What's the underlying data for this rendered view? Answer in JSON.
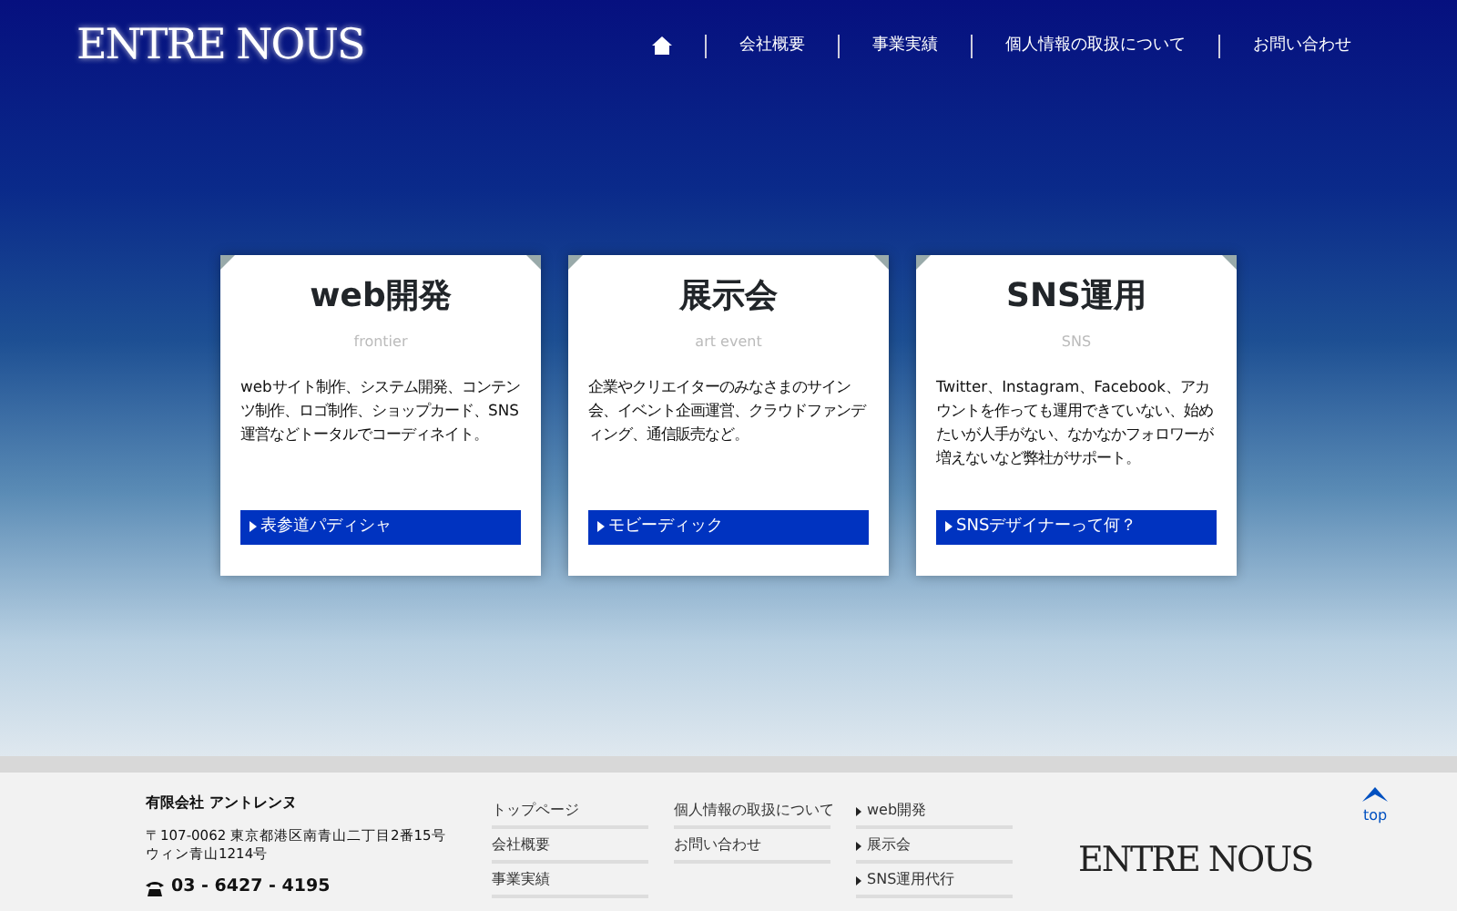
{
  "header": {
    "logo": "ENTRE NOUS",
    "nav": [
      {
        "kind": "home"
      },
      {
        "kind": "link",
        "label": "会社概要"
      },
      {
        "kind": "link",
        "label": "事業実績"
      },
      {
        "kind": "link",
        "label": "個人情報の取扱について"
      },
      {
        "kind": "link",
        "label": "お問い合わせ"
      }
    ]
  },
  "services": [
    {
      "title": "web開発",
      "subtitle": "frontier",
      "body": "webサイト制作、システム開発、コンテンツ制作、ロゴ制作、ショップカード、SNS運営などトータルでコーディネイト。",
      "button": "表参道パディシャ"
    },
    {
      "title": "展示会",
      "subtitle": "art event",
      "body": "企業やクリエイターのみなさまのサイン会、イベント企画運営、クラウドファンディング、通信販売など。",
      "button": "モビーディック"
    },
    {
      "title": "SNS運用",
      "subtitle": "SNS",
      "body": "Twitter、Instagram、Facebook、アカウントを作っても運用できていない、始めたいが人手がない、なかなかフォロワーが増えないなど弊社がサポート。",
      "button": "SNSデザイナーって何？"
    }
  ],
  "footer": {
    "company": "有限会社 アントレンヌ",
    "address": [
      "〒107-0062 東京都港区南青山二丁目2番15号",
      "ウィン青山1214号"
    ],
    "phone": "03 - 6427 - 4195",
    "link_columns": [
      [
        "トップページ",
        "会社概要",
        "事業実績"
      ],
      [
        "個人情報の取扱について",
        "お問い合わせ"
      ]
    ],
    "service_links": [
      "web開発",
      "展示会",
      "SNS運用代行"
    ],
    "logo": "ENTRE NOUS",
    "top_label": "top"
  }
}
